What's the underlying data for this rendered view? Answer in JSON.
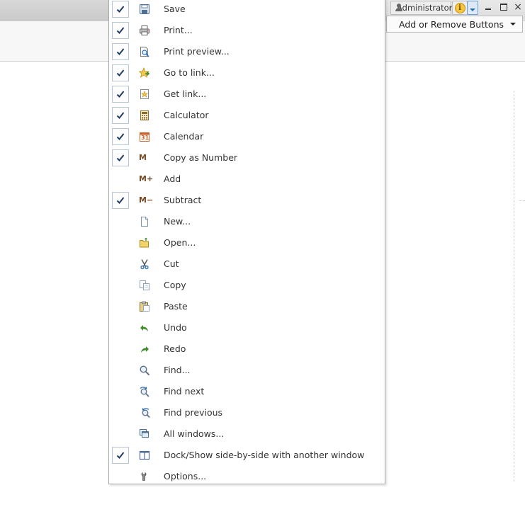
{
  "window": {
    "user_label": "Administrator",
    "info_glyph": "i",
    "close_glyph": "×"
  },
  "toolbar": {
    "add_remove_label": "Add or Remove Buttons"
  },
  "menu": {
    "items": [
      {
        "label": "Save",
        "checked": true,
        "icon": "save-icon"
      },
      {
        "label": "Print...",
        "checked": true,
        "icon": "print-icon"
      },
      {
        "label": "Print preview...",
        "checked": true,
        "icon": "print-preview-icon"
      },
      {
        "label": "Go to link...",
        "checked": true,
        "icon": "go-to-link-icon"
      },
      {
        "label": "Get link...",
        "checked": true,
        "icon": "get-link-icon"
      },
      {
        "label": "Calculator",
        "checked": true,
        "icon": "calculator-icon"
      },
      {
        "label": "Calendar",
        "checked": true,
        "icon": "calendar-icon",
        "icon_text": "31"
      },
      {
        "label": "Copy as Number",
        "checked": true,
        "icon": "m-icon",
        "icon_text": "M"
      },
      {
        "label": "Add",
        "checked": false,
        "icon": "m-plus-icon",
        "icon_text": "M+"
      },
      {
        "label": "Subtract",
        "checked": true,
        "icon": "m-minus-icon",
        "icon_text": "M−"
      },
      {
        "label": "New...",
        "checked": false,
        "icon": "new-document-icon"
      },
      {
        "label": "Open...",
        "checked": false,
        "icon": "open-folder-icon"
      },
      {
        "label": "Cut",
        "checked": false,
        "icon": "scissors-icon"
      },
      {
        "label": "Copy",
        "checked": false,
        "icon": "copy-icon"
      },
      {
        "label": "Paste",
        "checked": false,
        "icon": "paste-icon"
      },
      {
        "label": "Undo",
        "checked": false,
        "icon": "undo-icon"
      },
      {
        "label": "Redo",
        "checked": false,
        "icon": "redo-icon"
      },
      {
        "label": "Find...",
        "checked": false,
        "icon": "find-icon"
      },
      {
        "label": "Find next",
        "checked": false,
        "icon": "find-next-icon"
      },
      {
        "label": "Find previous",
        "checked": false,
        "icon": "find-previous-icon"
      },
      {
        "label": "All windows...",
        "checked": false,
        "icon": "all-windows-icon"
      },
      {
        "label": "Dock/Show side-by-side with another window",
        "checked": true,
        "icon": "dock-side-by-side-icon"
      },
      {
        "label": "Options...",
        "checked": false,
        "icon": "options-wrench-icon"
      }
    ]
  },
  "colors": {
    "check": "#1f3b63",
    "accent_blue": "#2b6fb5",
    "green_arrow": "#3d8a2b"
  }
}
